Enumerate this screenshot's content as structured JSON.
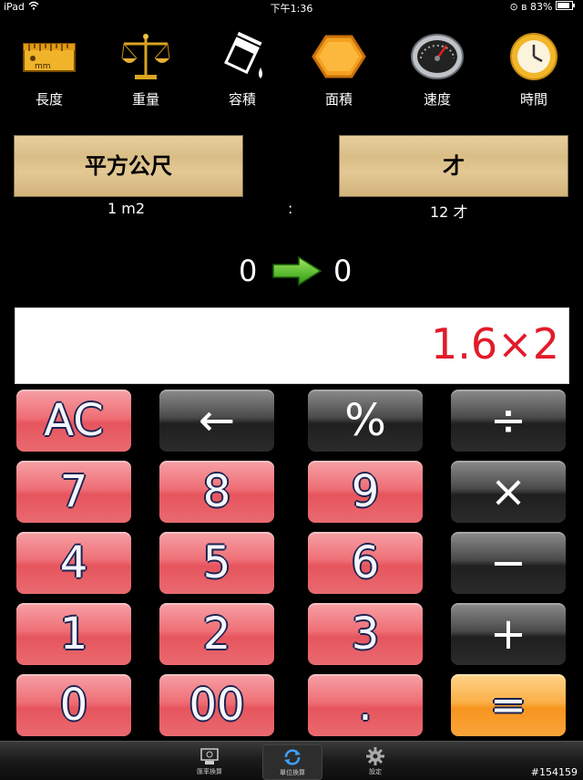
{
  "status": {
    "device": "iPad",
    "time": "下午1:36",
    "battery": "83%"
  },
  "categories": [
    {
      "label": "長度",
      "icon": "ruler-icon"
    },
    {
      "label": "重量",
      "icon": "scale-icon"
    },
    {
      "label": "容積",
      "icon": "container-icon"
    },
    {
      "label": "面積",
      "icon": "hexagon-icon"
    },
    {
      "label": "速度",
      "icon": "speedometer-icon"
    },
    {
      "label": "時間",
      "icon": "clock-icon"
    }
  ],
  "ruler_text": "mm",
  "units": {
    "from": "平方公尺",
    "to": "才"
  },
  "rate": {
    "from": "1  m2",
    "sep": ":",
    "to": "12  才"
  },
  "conversion": {
    "from_value": "0",
    "to_value": "0"
  },
  "display": {
    "value": "1.6×2"
  },
  "keys": {
    "ac": "AC",
    "back": "←",
    "percent": "%",
    "divide": "÷",
    "k7": "7",
    "k8": "8",
    "k9": "9",
    "multiply": "×",
    "k4": "4",
    "k5": "5",
    "k6": "6",
    "minus": "−",
    "k1": "1",
    "k2": "2",
    "k3": "3",
    "plus": "+",
    "k0": "0",
    "k00": "00",
    "dot": ".",
    "equals": "="
  },
  "tabs": [
    {
      "label": "匯率換算",
      "icon": "currency-icon"
    },
    {
      "label": "單位換算",
      "icon": "refresh-icon"
    },
    {
      "label": "設定",
      "icon": "gear-icon"
    }
  ],
  "watermark": "#154159",
  "colors": {
    "display_text": "#e21b2a",
    "key_red": "#ef6f76",
    "key_dark": "#2b2b2b",
    "key_orange": "#f7951e",
    "unit_tan": "#d9bd86"
  }
}
